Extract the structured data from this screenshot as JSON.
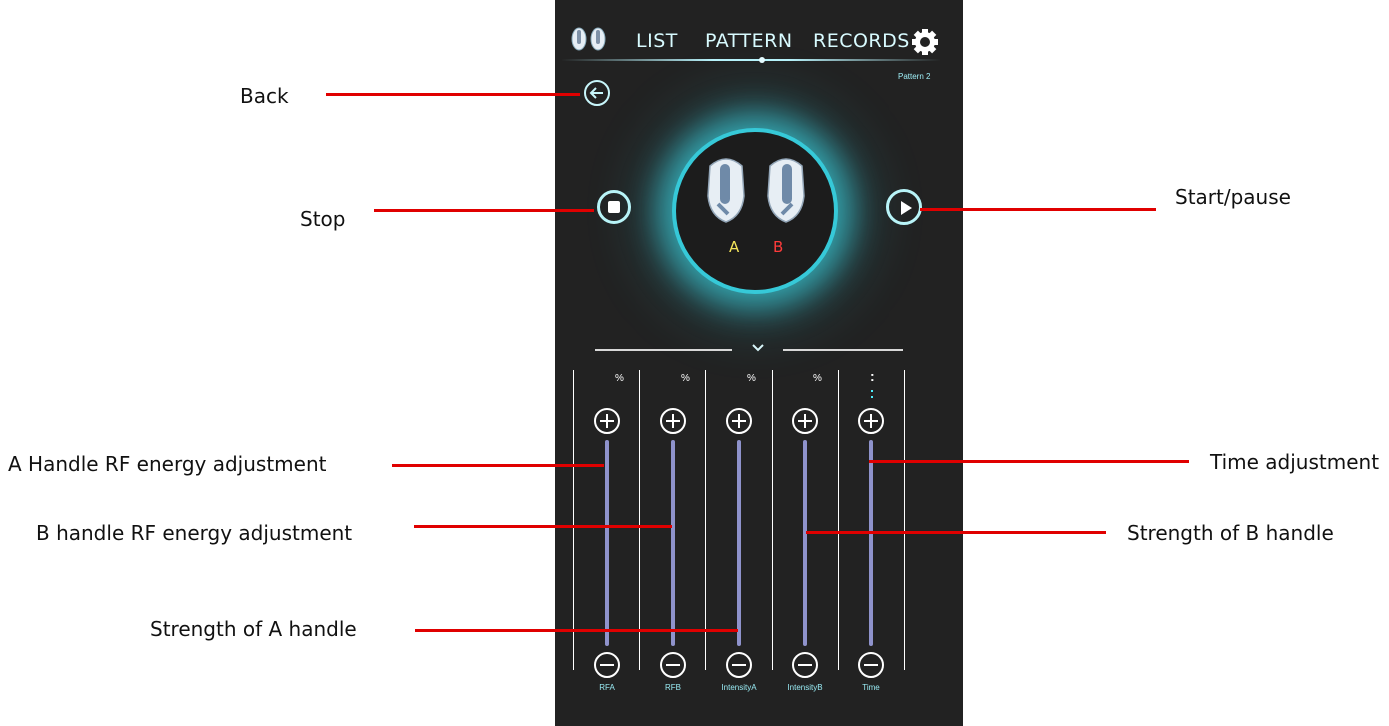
{
  "nav": {
    "list": "LIST",
    "pattern": "PATTERN",
    "records": "RECORDS"
  },
  "pattern_label": "Pattern 2",
  "handles": {
    "a": "A",
    "b": "B"
  },
  "annotations": {
    "back": "Back",
    "stop": "Stop",
    "start_pause": "Start/pause",
    "rfa": "A Handle RF energy adjustment",
    "rfb": "B handle RF energy adjustment",
    "intensity_a": "Strength of A handle",
    "time": "Time adjustment",
    "intensity_b": "Strength of B handle"
  },
  "sliders": [
    {
      "unit": "%",
      "label": "RFA"
    },
    {
      "unit": "%",
      "label": "RFB"
    },
    {
      "unit": "%",
      "label": "IntensityA"
    },
    {
      "unit": "%",
      "label": "IntensityB"
    },
    {
      "unit": ":",
      "label": "Time"
    }
  ],
  "colors": {
    "accent": "#4ff0ff",
    "handle_a": "#f2e35a",
    "handle_b": "#ff3b3b",
    "annotation_line": "#e00000"
  }
}
